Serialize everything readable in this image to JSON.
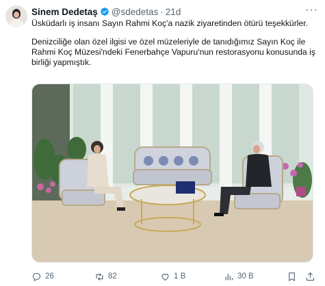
{
  "tweet": {
    "author_name": "Sinem Dedetaş",
    "handle": "@sdedetas",
    "separator": "·",
    "time": "21d",
    "more": "···",
    "paragraph1": "Üsküdarlı iş insanı Sayın Rahmi Koç'a nazik ziyaretinden ötürü teşekkürler.",
    "paragraph2": "Denizciliğe olan özel ilgisi ve özel müzeleriyle de tanıdığımız Sayın Koç ile Rahmi Koç Müzesi'ndeki Fenerbahçe Vapuru'nun restorasyonu konusunda iş birliği yapmıştık."
  },
  "actions": {
    "replies": "26",
    "reposts": "82",
    "likes": "1 B",
    "views": "30 B"
  },
  "icons": {
    "verified": "verified-badge-icon",
    "reply": "reply-icon",
    "repost": "repost-icon",
    "like": "heart-icon",
    "views": "views-icon",
    "bookmark": "bookmark-icon",
    "share": "share-icon"
  },
  "colors": {
    "verified": "#1d9bf0",
    "secondary_text": "#536471",
    "primary_text": "#0f1419"
  }
}
